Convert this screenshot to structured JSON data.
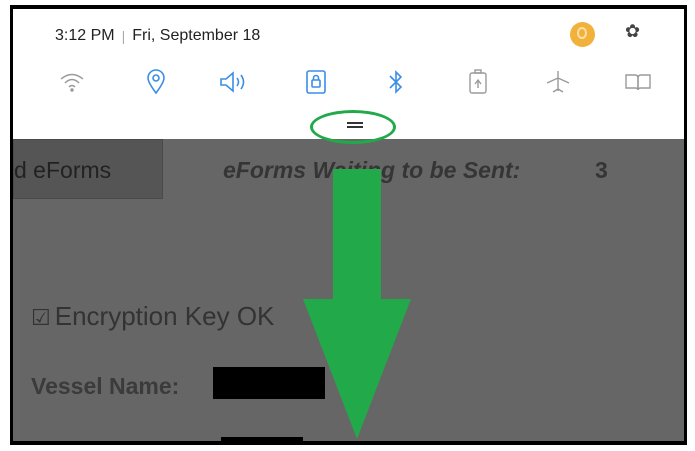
{
  "status": {
    "time": "3:12 PM",
    "separator": "|",
    "date": "Fri, September 18"
  },
  "quick_settings": {
    "icons": [
      "wifi-icon",
      "location-icon",
      "sound-icon",
      "lock-rotation-icon",
      "bluetooth-icon",
      "power-saving-icon",
      "airplane-mode-icon",
      "reading-mode-icon"
    ],
    "active_color": "#3a8ee6",
    "inactive_color": "#9a9a9a"
  },
  "app": {
    "send_button_label": "d eForms",
    "waiting_label": "eForms Waiting to be Sent:",
    "waiting_count": "3",
    "encryption_label": "Encryption Key OK",
    "encryption_checked": true,
    "vessel_label": "Vessel Name:"
  },
  "annotation": {
    "color": "#22a94a"
  }
}
